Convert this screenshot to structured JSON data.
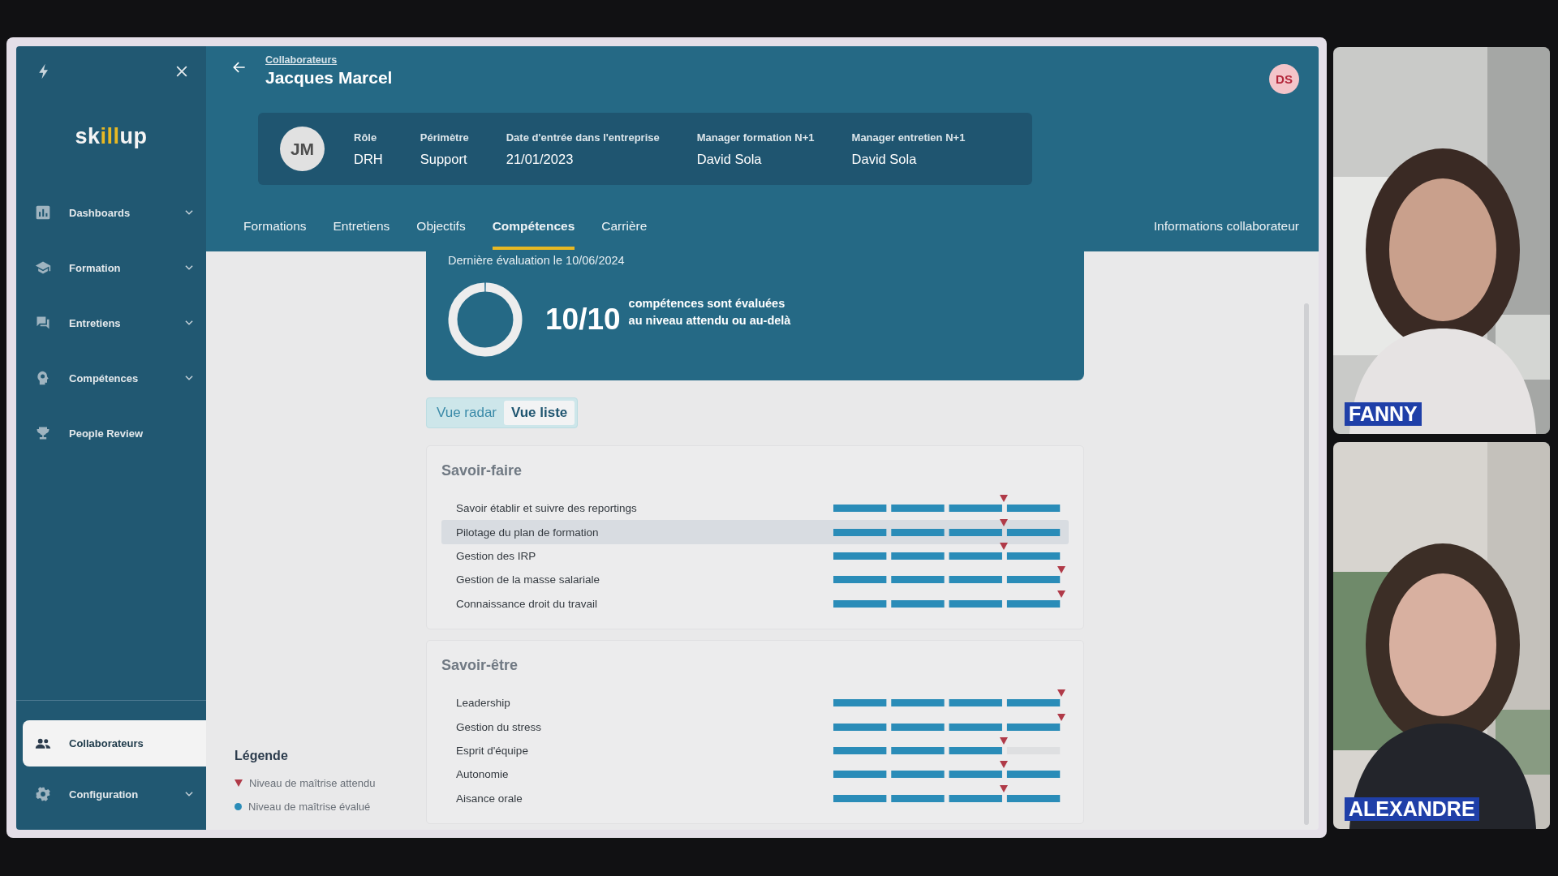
{
  "sidebar": {
    "logo": [
      {
        "text": "sk",
        "accent": false
      },
      {
        "text": "ill",
        "accent": true
      },
      {
        "text": "up",
        "accent": false
      }
    ],
    "items": [
      {
        "label": "Dashboards",
        "expandable": true,
        "selected": false
      },
      {
        "label": "Formation",
        "expandable": true,
        "selected": false
      },
      {
        "label": "Entretiens",
        "expandable": true,
        "selected": false
      },
      {
        "label": "Compétences",
        "expandable": true,
        "selected": false
      },
      {
        "label": "People Review",
        "expandable": false,
        "selected": false
      }
    ],
    "bottom_items": [
      {
        "label": "Collaborateurs",
        "expandable": false,
        "selected": true
      },
      {
        "label": "Configuration",
        "expandable": true,
        "selected": false
      }
    ]
  },
  "header": {
    "breadcrumb": "Collaborateurs",
    "title": "Jacques Marcel",
    "user_initials": "DS",
    "profile": {
      "initials": "JM",
      "fields": [
        {
          "label": "Rôle",
          "value": "DRH"
        },
        {
          "label": "Périmètre",
          "value": "Support"
        },
        {
          "label": "Date d'entrée dans l'entreprise",
          "value": "21/01/2023"
        },
        {
          "label": "Manager formation N+1",
          "value": "David Sola"
        },
        {
          "label": "Manager entretien N+1",
          "value": "David Sola"
        }
      ]
    },
    "tabs": [
      {
        "label": "Formations",
        "selected": false
      },
      {
        "label": "Entretiens",
        "selected": false
      },
      {
        "label": "Objectifs",
        "selected": false
      },
      {
        "label": "Compétences",
        "selected": true
      },
      {
        "label": "Carrière",
        "selected": false
      }
    ],
    "info_link": "Informations collaborateur"
  },
  "summary": {
    "last_evaluation": "Dernière évaluation le 10/06/2024",
    "score": "10/10",
    "level": 1,
    "text_line_1": "compétences sont évaluées",
    "text_line_2": "au niveau attendu ou au-delà"
  },
  "view_toggle": [
    {
      "label": "Vue radar",
      "selected": false
    },
    {
      "label": "Vue liste",
      "selected": true
    }
  ],
  "sections": [
    {
      "title": "Savoir-faire",
      "skills": [
        {
          "name": "Savoir établir et suivre des reportings",
          "level": 1,
          "target": {
            "level": 0.75
          },
          "hovered": false
        },
        {
          "name": "Pilotage du plan de formation",
          "level": 1,
          "target": {
            "level": 0.75
          },
          "hovered": true
        },
        {
          "name": "Gestion des IRP",
          "level": 1,
          "target": {
            "level": 0.75
          },
          "hovered": false
        },
        {
          "name": "Gestion de la masse salariale",
          "level": 1,
          "target": {
            "level": 1
          },
          "hovered": false
        },
        {
          "name": "Connaissance droit du travail",
          "level": 1,
          "target": {
            "level": 1
          },
          "hovered": false
        }
      ]
    },
    {
      "title": "Savoir-être",
      "skills": [
        {
          "name": "Leadership",
          "level": 1,
          "target": {
            "level": 1
          },
          "hovered": false
        },
        {
          "name": "Gestion du stress",
          "level": 1,
          "target": {
            "level": 1
          },
          "hovered": false
        },
        {
          "name": "Esprit d'équipe",
          "level": 0.75,
          "target": {
            "level": 0.75
          },
          "hovered": false
        },
        {
          "name": "Autonomie",
          "level": 1,
          "target": {
            "level": 0.75
          },
          "hovered": false
        },
        {
          "name": "Aisance orale",
          "level": 1,
          "target": {
            "level": 0.75
          },
          "hovered": false
        }
      ]
    }
  ],
  "legend": {
    "title": "Légende",
    "items": [
      {
        "kind": "triangle",
        "label": "Niveau de maîtrise attendu",
        "color": "#b03a48"
      },
      {
        "kind": "dot",
        "label": "Niveau de maîtrise évalué",
        "color": "#2a8cb8"
      }
    ]
  },
  "participants": [
    {
      "name": "FANNY",
      "kind": "picture"
    },
    {
      "name": "ALEXANDRE",
      "kind": "picture"
    }
  ]
}
